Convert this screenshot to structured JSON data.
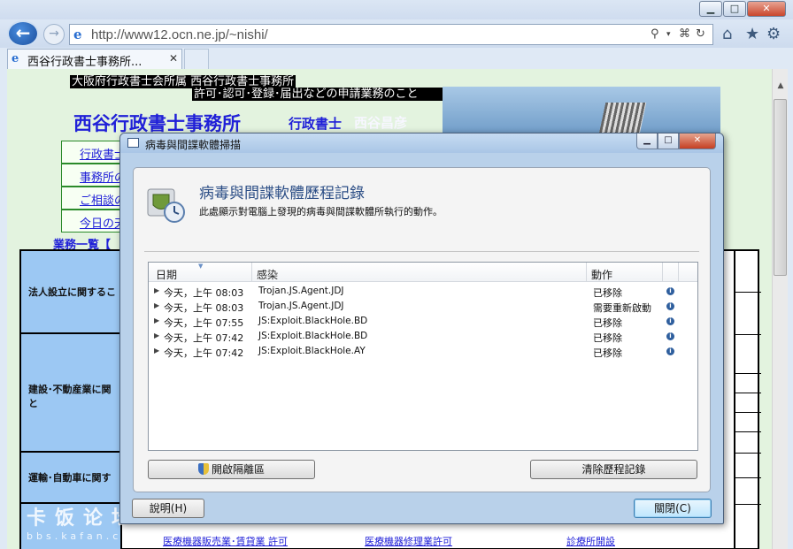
{
  "browser": {
    "window_controls": {
      "minimize": "▁",
      "maximize": "□",
      "close": "✕"
    },
    "back_icon": "←",
    "forward_icon": "→",
    "url": "http://www12.ocn.ne.jp/~nishi/",
    "tab_title": "西谷行政書士事務所...",
    "tab_close": "✕",
    "tools": {
      "search": "⚲",
      "dropdown": "▾",
      "compat": "⌘",
      "refresh": "↻",
      "home": "⌂",
      "favorites": "★",
      "settings": "⚙"
    }
  },
  "page": {
    "header_line1": "大阪府行政書士会所属 西谷行政書士事務所",
    "header_line2": "許可･認可･登録･届出などの申請業務のこと",
    "site_title": "西谷行政書士事務所",
    "site_role": "行政書士",
    "site_name": "西谷昌彦",
    "nav_links": [
      "行政書士",
      "事務所の",
      "ご相談の",
      "今日の天"
    ],
    "menu_heading": "業務一覧【",
    "categories": [
      "法人設立に関するこ",
      "建設･不動産業に関と",
      "運輸･自動車に関す",
      ""
    ],
    "bottom_links": [
      "医療機器販売業･賃貸業 許可",
      "医療機器修理業許可",
      "診療所開設"
    ],
    "watermark_brand": "卡饭论坛",
    "watermark_url": "bbs.kafan.cn"
  },
  "dialog": {
    "title": "病毒與間諜軟體掃描",
    "heading": "病毒與間諜軟體歷程記錄",
    "description": "此處顯示對電腦上發現的病毒與間諜軟體所執行的動作。",
    "columns": {
      "date": "日期",
      "threat": "感染",
      "action": "動作"
    },
    "rows": [
      {
        "date": "今天，上午 08:03",
        "threat": "Trojan.JS.Agent.JDJ",
        "action": "已移除"
      },
      {
        "date": "今天，上午 08:03",
        "threat": "Trojan.JS.Agent.JDJ",
        "action": "需要重新啟動"
      },
      {
        "date": "今天，上午 07:55",
        "threat": "JS:Exploit.BlackHole.BD",
        "action": "已移除"
      },
      {
        "date": "今天，上午 07:42",
        "threat": "JS:Exploit.BlackHole.BD",
        "action": "已移除"
      },
      {
        "date": "今天，上午 07:42",
        "threat": "JS:Exploit.BlackHole.AY",
        "action": "已移除"
      }
    ],
    "row_expand_icon": "▶",
    "row_info_icon": "i",
    "buttons": {
      "open_quarantine": "開啟隔離區",
      "clear_history": "清除歷程記錄",
      "help": "說明(H)",
      "close": "關閉(C)"
    },
    "window_controls": {
      "minimize": "▁",
      "maximize": "□",
      "close": "✕"
    }
  }
}
